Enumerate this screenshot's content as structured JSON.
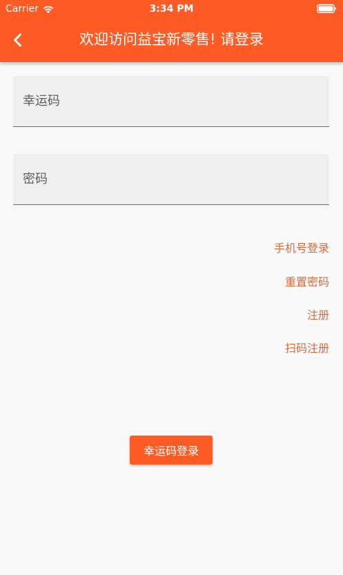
{
  "status_bar": {
    "carrier": "Carrier",
    "time": "3:34 PM",
    "wifi_icon": "wifi-icon",
    "battery_icon": "battery-icon"
  },
  "app_bar": {
    "title": "欢迎访问益宝新零售! 请登录",
    "back_icon": "chevron-left-icon",
    "background_color": "#fe5a23",
    "text_color": "#ffffff"
  },
  "form": {
    "lucky_code": {
      "placeholder": "幸运码",
      "value": ""
    },
    "password": {
      "placeholder": "密码",
      "value": ""
    }
  },
  "links": {
    "phone_login": "手机号登录",
    "reset_password": "重置密码",
    "register": "注册",
    "scan_register": "扫码注册",
    "color": "#d86a3c"
  },
  "login_button": {
    "label": "幸运码登录"
  }
}
